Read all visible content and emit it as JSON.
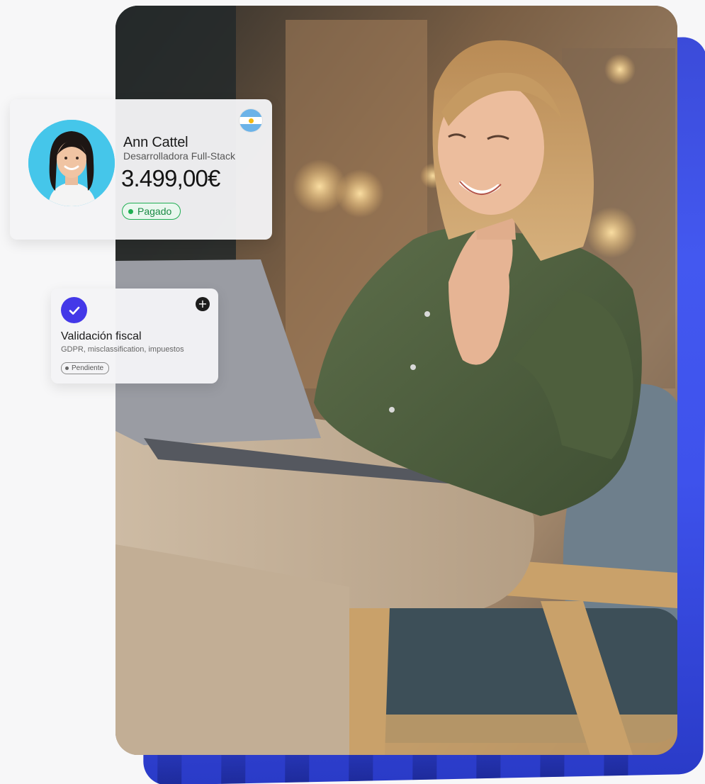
{
  "profile_card": {
    "name": "Ann Cattel",
    "role": "Desarrolladora Full-Stack",
    "amount": "3.499,00€",
    "status": "Pagado",
    "status_color": "#1fae52",
    "flag_icon": "argentina-flag-icon",
    "avatar_icon": "woman-portrait-avatar"
  },
  "task_card": {
    "title": "Validación fiscal",
    "subtitle": "GDPR, misclassification, impuestos",
    "status": "Pendiente",
    "check_icon": "check-circle-icon",
    "add_icon": "plus-circle-icon",
    "accent_color": "#4338e8"
  },
  "hero": {
    "photo": "woman-waving-at-laptop-photo",
    "backdrop_color": "#4358f0"
  }
}
